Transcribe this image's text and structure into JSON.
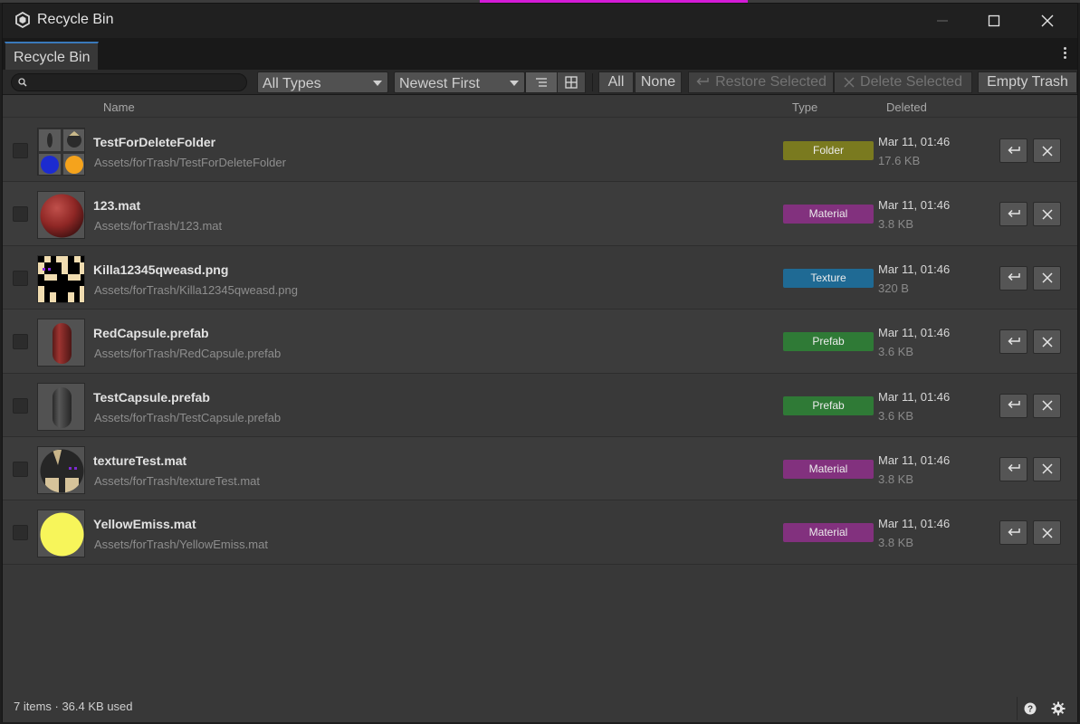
{
  "window": {
    "title": "Recycle Bin"
  },
  "tab": {
    "label": "Recycle Bin"
  },
  "toolbar": {
    "search_value": "",
    "type_filter": "All Types",
    "sort_order": "Newest First",
    "all_label": "All",
    "none_label": "None",
    "restore_selected_label": "Restore Selected",
    "delete_selected_label": "Delete Selected",
    "empty_trash_label": "Empty Trash"
  },
  "columns": {
    "name": "Name",
    "type": "Type",
    "deleted": "Deleted"
  },
  "type_colors": {
    "Folder": "#7a7a1f",
    "Material": "#82317e",
    "Texture": "#1f6a94",
    "Prefab": "#2f7a36"
  },
  "items": [
    {
      "name": "TestForDeleteFolder",
      "path": "Assets/forTrash/TestForDeleteFolder",
      "type": "Folder",
      "deleted": "Mar 11, 01:46",
      "size": "17.6 KB",
      "thumbnail": "folder-preview-grid"
    },
    {
      "name": "123.mat",
      "path": "Assets/forTrash/123.mat",
      "type": "Material",
      "deleted": "Mar 11, 01:46",
      "size": "3.8 KB",
      "thumbnail": "red-sphere"
    },
    {
      "name": "Killa12345qweasd.png",
      "path": "Assets/forTrash/Killa12345qweasd.png",
      "type": "Texture",
      "deleted": "Mar 11, 01:46",
      "size": "320 B",
      "thumbnail": "pixel-face-texture"
    },
    {
      "name": "RedCapsule.prefab",
      "path": "Assets/forTrash/RedCapsule.prefab",
      "type": "Prefab",
      "deleted": "Mar 11, 01:46",
      "size": "3.6 KB",
      "thumbnail": "red-capsule"
    },
    {
      "name": "TestCapsule.prefab",
      "path": "Assets/forTrash/TestCapsule.prefab",
      "type": "Prefab",
      "deleted": "Mar 11, 01:46",
      "size": "3.6 KB",
      "thumbnail": "gray-capsule"
    },
    {
      "name": "textureTest.mat",
      "path": "Assets/forTrash/textureTest.mat",
      "type": "Material",
      "deleted": "Mar 11, 01:46",
      "size": "3.8 KB",
      "thumbnail": "textured-sphere"
    },
    {
      "name": "YellowEmiss.mat",
      "path": "Assets/forTrash/YellowEmiss.mat",
      "type": "Material",
      "deleted": "Mar 11, 01:46",
      "size": "3.8 KB",
      "thumbnail": "yellow-sphere"
    }
  ],
  "status": {
    "text": "7 items  ·  36.4 KB used"
  }
}
